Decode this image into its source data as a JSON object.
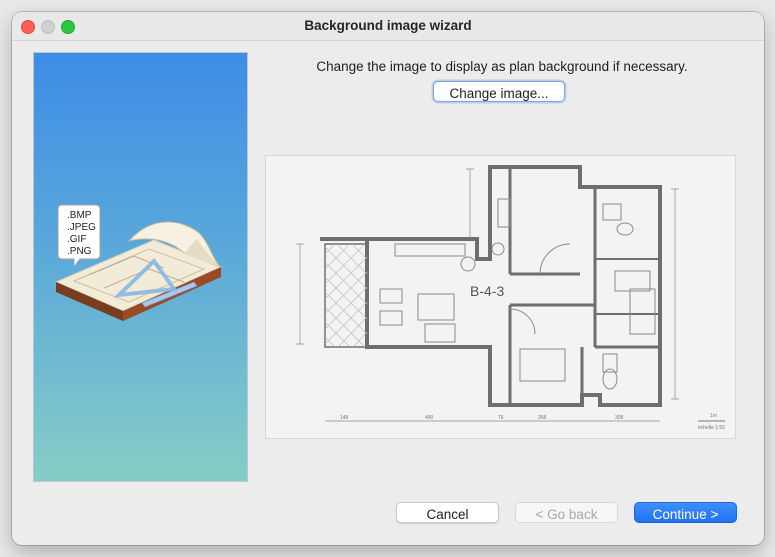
{
  "window": {
    "title": "Background image wizard"
  },
  "wizard": {
    "instruction": "Change the image to display as plan background if necessary.",
    "change_image_label": "Change image...",
    "formats": [
      ".BMP",
      ".JPEG",
      ".GIF",
      ".PNG"
    ]
  },
  "plan": {
    "room_label": "B-4-3",
    "scale_text": "1m",
    "scale_ratio": "échelle 1:50",
    "dimensions": [
      "148",
      "490",
      "76",
      "268",
      "308"
    ]
  },
  "footer": {
    "cancel_label": "Cancel",
    "back_label": "< Go back",
    "continue_label": "Continue >"
  },
  "colors": {
    "accent": "#1f73f2",
    "close": "#fe5f57",
    "zoom": "#2ac840",
    "panel_top": "#3d8de6",
    "panel_bottom": "#86cdc6"
  }
}
